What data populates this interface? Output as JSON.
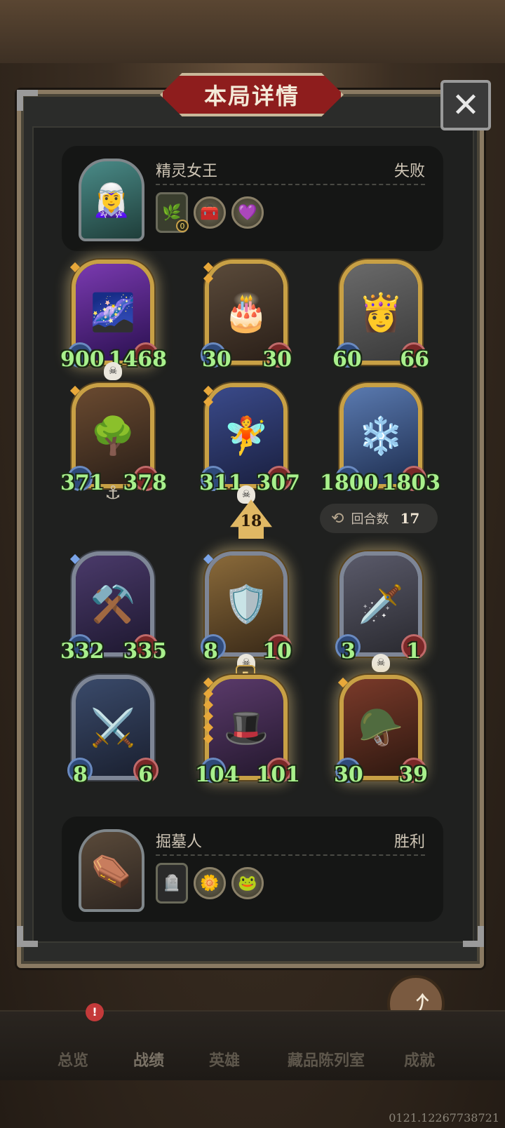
{
  "dialog": {
    "title": "本局详情",
    "close_label": "✕"
  },
  "top_player": {
    "name": "精灵女王",
    "result": "失败",
    "hero_icon": "elf-queen-portrait",
    "item_level": "0"
  },
  "bottom_player": {
    "name": "掘墓人",
    "result": "胜利",
    "hero_icon": "gravedigger-portrait"
  },
  "top_board": [
    {
      "atk": "900",
      "hp": "1468"
    },
    {
      "atk": "30",
      "hp": "30"
    },
    {
      "atk": "60",
      "hp": "66"
    },
    {
      "atk": "371",
      "hp": "378"
    },
    {
      "atk": "311",
      "hp": "307"
    },
    {
      "atk": "1800",
      "hp": "1803"
    }
  ],
  "bottom_board": [
    {
      "atk": "332",
      "hp": "335"
    },
    {
      "atk": "8",
      "hp": "10"
    },
    {
      "atk": "3",
      "hp": "1"
    },
    {
      "atk": "8",
      "hp": "6"
    },
    {
      "atk": "104",
      "hp": "101"
    },
    {
      "atk": "30",
      "hp": "39"
    }
  ],
  "turn_damage": "18",
  "round": {
    "label": "回合数",
    "value": "17"
  },
  "mini_marker": "5",
  "share": {
    "label": "分享"
  },
  "nav": {
    "overview": "总览",
    "record": "战绩",
    "heroes": "英雄",
    "collection": "藏品陈列室",
    "achievements": "成就",
    "badge": "!"
  },
  "footer_id": "0121.12267738721"
}
